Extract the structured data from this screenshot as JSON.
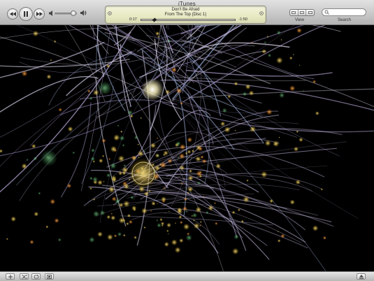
{
  "window": {
    "title": "iTunes"
  },
  "controls": {
    "previous_icon": "rewind-icon",
    "play_pause_icon": "pause-icon",
    "next_icon": "fast-forward-icon",
    "volume_low_icon": "speaker-low-icon",
    "volume_high_icon": "speaker-high-icon",
    "volume_level": 0.85
  },
  "now_playing": {
    "song": "Don't Be Afraid",
    "album": "From The Top (Disc 1)",
    "elapsed": "0:17",
    "remaining": "-1:50",
    "progress": 0.13
  },
  "view": {
    "label": "View"
  },
  "search": {
    "label": "Search",
    "placeholder": "",
    "value": ""
  },
  "bottom_bar": {
    "add_icon": "plus-icon",
    "shuffle_icon": "shuffle-icon",
    "repeat_icon": "repeat-icon",
    "artwork_icon": "artwork-icon",
    "eject_icon": "eject-icon"
  },
  "colors": {
    "lcd_background": "#e7e9c3",
    "visualizer_background": "#000000"
  }
}
